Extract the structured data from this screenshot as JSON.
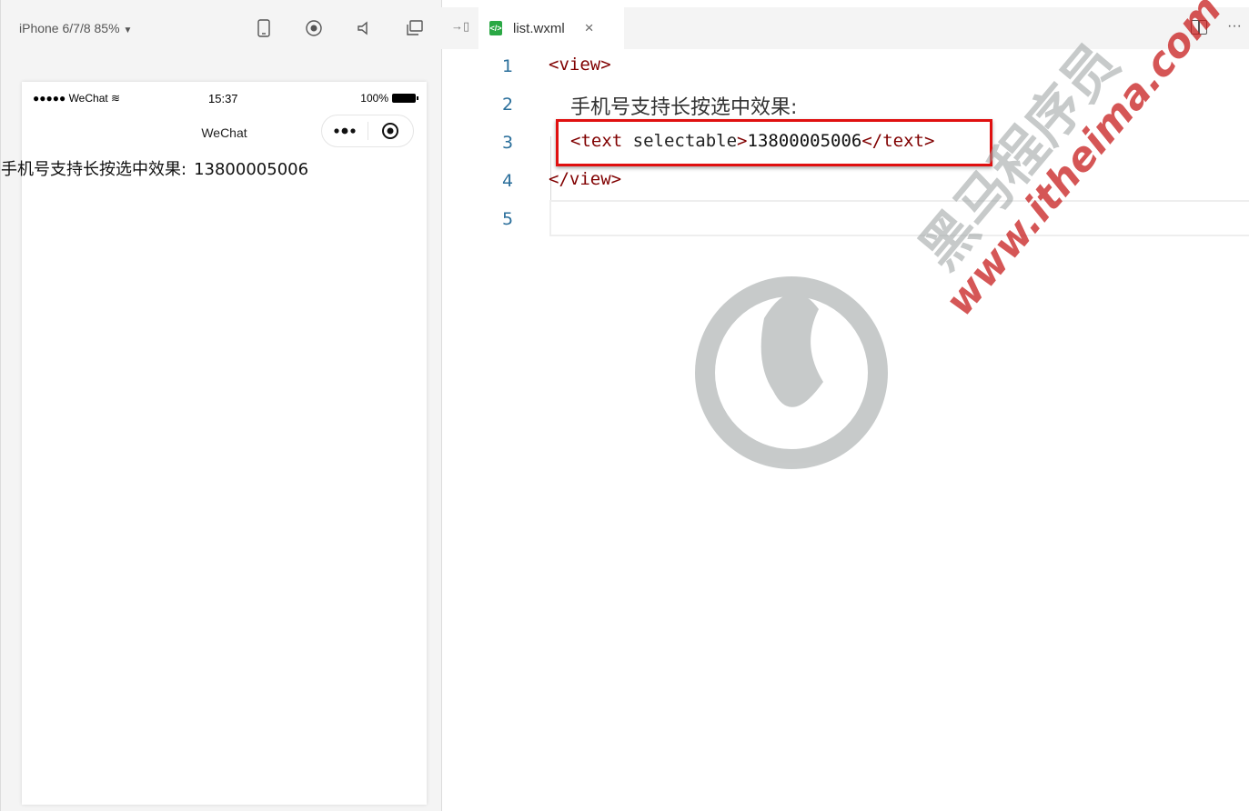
{
  "simulator": {
    "device_label": "iPhone 6/7/8 85%",
    "status_bar": {
      "carrier": "●●●●● WeChat",
      "time": "15:37",
      "battery": "100%"
    },
    "nav_title": "WeChat",
    "page_text": "手机号支持长按选中效果:",
    "page_number": "13800005006"
  },
  "editor": {
    "tab": {
      "filename": "list.wxml",
      "close_glyph": "×"
    },
    "line_numbers": [
      "1",
      "2",
      "3",
      "4",
      "5"
    ],
    "code": {
      "line1": "<view>",
      "line2": "手机号支持长按选中效果:",
      "line3_open": "<text",
      "line3_attr": " selectable",
      "line3_gt": ">",
      "line3_value": "13800005006",
      "line3_close": "</text>",
      "line4": "</view>"
    },
    "more_glyph": "···"
  },
  "watermark": {
    "url_text": "www.itheima.com",
    "brand_text": "黑马程序员"
  },
  "colors": {
    "tag": "#800000",
    "line_number": "#2b6f9b",
    "highlight": "#e01010",
    "file_icon": "#2aa844"
  }
}
